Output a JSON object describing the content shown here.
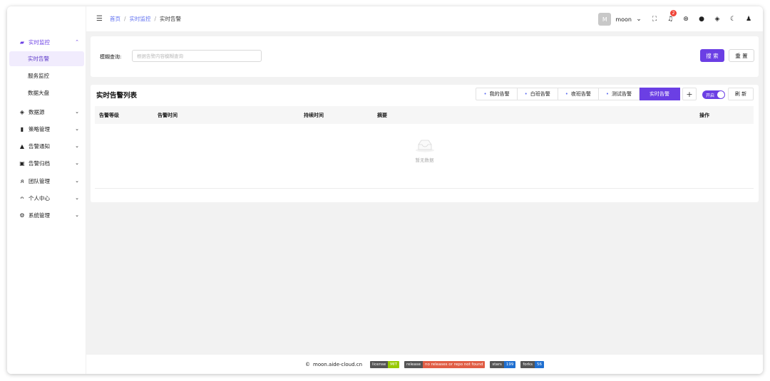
{
  "sidebar": {
    "groups": [
      {
        "label": "实时监控",
        "icon": "monitor-icon",
        "expanded": true
      },
      {
        "label": "数据源",
        "icon": "layers-icon"
      },
      {
        "label": "策略管理",
        "icon": "book-icon"
      },
      {
        "label": "告警通知",
        "icon": "bell-icon"
      },
      {
        "label": "告警归档",
        "icon": "archive-icon"
      },
      {
        "label": "团队管理",
        "icon": "team-icon"
      },
      {
        "label": "个人中心",
        "icon": "user-icon"
      },
      {
        "label": "系统管理",
        "icon": "gear-icon"
      }
    ],
    "sub_items": [
      {
        "label": "实时告警",
        "selected": true
      },
      {
        "label": "服务监控"
      },
      {
        "label": "数据大盘"
      }
    ]
  },
  "header": {
    "breadcrumb": [
      "首页",
      "实时监控",
      "实时告警"
    ],
    "avatar_letter": "M",
    "username": "moon",
    "notification_count": "2"
  },
  "search": {
    "label": "模糊查询:",
    "placeholder": "根据告警内容模糊查询",
    "search_button": "搜 索",
    "reset_button": "重 置"
  },
  "list": {
    "title": "实时告警列表",
    "tabs": [
      "我的告警",
      "白班告警",
      "夜班告警",
      "测试告警",
      "实时告警"
    ],
    "active_tab": "实时告警",
    "add_button": "+",
    "toggle_label": "开启",
    "refresh_button": "刷 新",
    "columns": [
      "告警等级",
      "告警时间",
      "持续时间",
      "摘要",
      "操作"
    ],
    "empty_text": "暂无数据"
  },
  "footer": {
    "site": "moon.aide-cloud.cn",
    "shields": [
      {
        "label": "license",
        "value": "MIT",
        "color": "#97ca00"
      },
      {
        "label": "release",
        "value": "no releases or repo not found",
        "color": "#e05d44"
      },
      {
        "label": "stars",
        "value": "199",
        "color": "#1f6fd0"
      },
      {
        "label": "forks",
        "value": "56",
        "color": "#1f6fd0"
      }
    ]
  },
  "colors": {
    "accent": "#6b3fe4",
    "link": "#5b6cf0"
  }
}
